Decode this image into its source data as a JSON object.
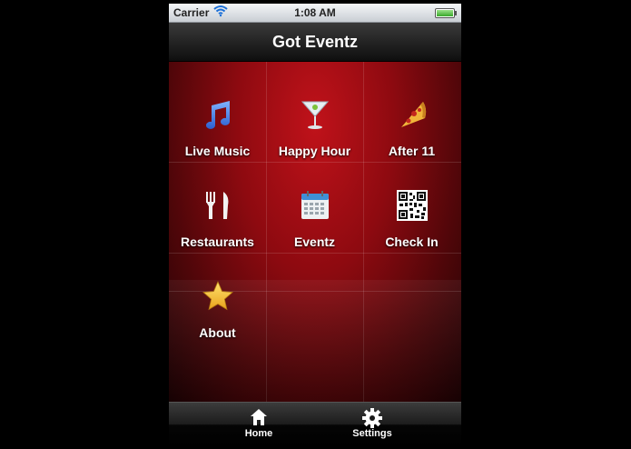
{
  "status_bar": {
    "carrier": "Carrier",
    "time": "1:08 AM"
  },
  "nav": {
    "title": "Got Eventz"
  },
  "tiles": [
    {
      "label": "Live Music",
      "icon": "music-note-icon"
    },
    {
      "label": "Happy Hour",
      "icon": "cocktail-glass-icon"
    },
    {
      "label": "After 11",
      "icon": "pizza-slice-icon"
    },
    {
      "label": "Restaurants",
      "icon": "fork-knife-icon"
    },
    {
      "label": "Eventz",
      "icon": "calendar-icon"
    },
    {
      "label": "Check In",
      "icon": "qr-code-icon"
    },
    {
      "label": "About",
      "icon": "star-icon"
    }
  ],
  "tab_bar": [
    {
      "label": "Home",
      "icon": "home-icon"
    },
    {
      "label": "Settings",
      "icon": "gear-icon"
    }
  ],
  "colors": {
    "accent": "#b0101a",
    "background": "#000000"
  }
}
